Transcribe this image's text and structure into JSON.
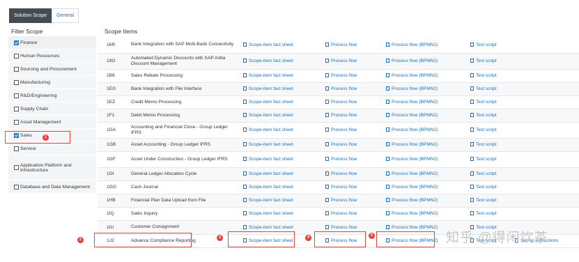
{
  "tabs": [
    {
      "label": "Solution Scope",
      "active": true
    },
    {
      "label": "General",
      "active": false
    }
  ],
  "filter_scope": {
    "title": "Filter Scope",
    "items": [
      {
        "label": "Finance",
        "checked": true
      },
      {
        "label": "Human Resources",
        "checked": false
      },
      {
        "label": "Sourcing and Procurement",
        "checked": false
      },
      {
        "label": "Manufacturing",
        "checked": false
      },
      {
        "label": "R&D/Engineering",
        "checked": false
      },
      {
        "label": "Supply Chain",
        "checked": false
      },
      {
        "label": "Asset Management",
        "checked": false
      },
      {
        "label": "Sales",
        "checked": true
      },
      {
        "label": "Service",
        "checked": false
      },
      {
        "label": "Application Platform and Infrastructure",
        "checked": false
      },
      {
        "label": "Database and Data Management",
        "checked": false
      }
    ]
  },
  "scope_items": {
    "title": "Scope Items",
    "link_labels": {
      "fact_sheet": "Scope-item fact sheet",
      "process_flow": "Process flow",
      "bpmn": "Process flow (BPMN2)",
      "test_script": "Test script",
      "setup": "Set-up instructions"
    },
    "rows": [
      {
        "id": "16R",
        "name": "Bank Integration with SAP Multi-Bank Connectivity"
      },
      {
        "id": "19O",
        "name": "Automated Dynamic Discounts with SAP Ariba Discount Management"
      },
      {
        "id": "1B6",
        "name": "Sales Rebate Processing"
      },
      {
        "id": "1EG",
        "name": "Bank Integration with File Interface"
      },
      {
        "id": "1EZ",
        "name": "Credit Memo Processing"
      },
      {
        "id": "1F1",
        "name": "Debit Memo Processing"
      },
      {
        "id": "1GA",
        "name": "Accounting and Financial Close - Group Ledger IFRS"
      },
      {
        "id": "1GB",
        "name": "Asset Accounting - Group Ledger IFRS"
      },
      {
        "id": "1GF",
        "name": "Asset Under Construction - Group Ledger IFRS"
      },
      {
        "id": "1GI",
        "name": "General Ledger Allocation Cycle"
      },
      {
        "id": "1GO",
        "name": "Cash Journal"
      },
      {
        "id": "1HB",
        "name": "Financial Plan Data Upload from File"
      },
      {
        "id": "1IQ",
        "name": "Sales Inquiry"
      },
      {
        "id": "1IU",
        "name": "Customer Consignment"
      },
      {
        "id": "1J2",
        "name": "Advance Compliance Reporting",
        "has_setup": true
      }
    ]
  },
  "annotations": [
    "1",
    "2",
    "3",
    "4",
    "5"
  ],
  "watermark": "知乎 @得闲饮茶",
  "colors": {
    "accent": "#1a6fc6",
    "highlight": "#e8403a",
    "active_tab": "#444b55"
  }
}
